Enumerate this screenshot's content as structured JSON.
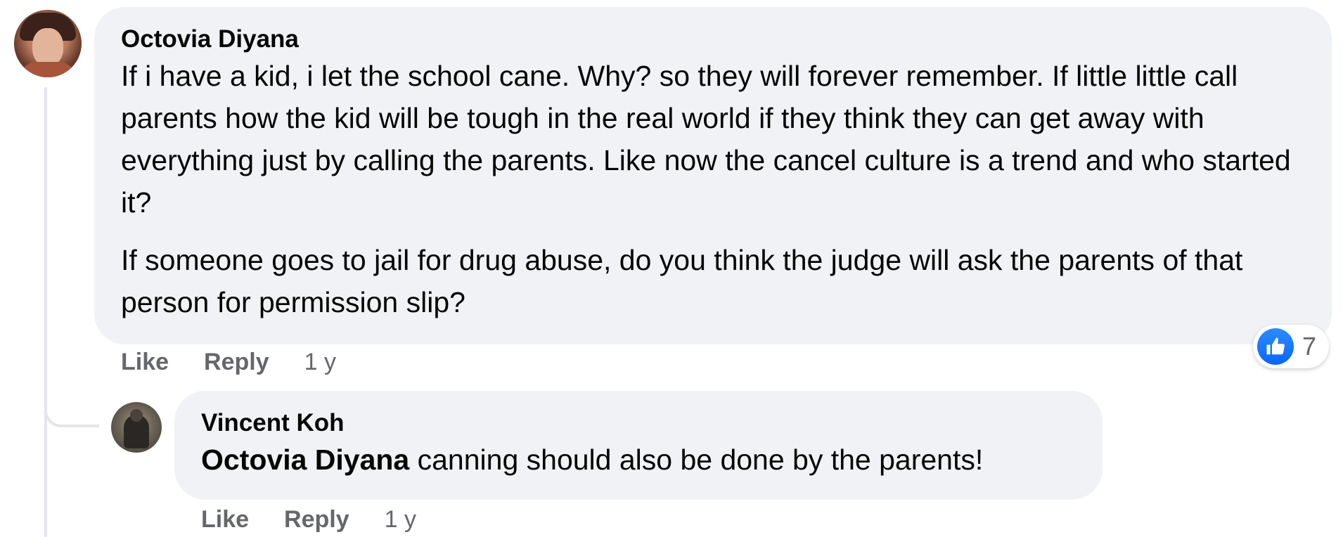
{
  "comment": {
    "author": "Octovia Diyana",
    "paragraphs": [
      "If i have a kid, i let the school cane. Why? so they will forever remember. If little little call parents how the kid will be tough in the real world if they think they can get away with everything just by calling the parents. Like now the cancel culture is a trend and who started it?",
      "If someone goes to jail for drug abuse, do you think the judge will ask the parents of that person for permission slip?"
    ],
    "reaction_count": "7",
    "reaction_icon": "thumbs-up-icon",
    "actions": {
      "like": "Like",
      "reply": "Reply",
      "time": "1 y"
    }
  },
  "reply": {
    "author": "Vincent Koh",
    "mention": "Octovia Diyana",
    "text": " canning should also be done by the parents!",
    "actions": {
      "like": "Like",
      "reply": "Reply",
      "time": "1 y"
    }
  },
  "colors": {
    "bubble": "#f0f2f5",
    "secondary_text": "#65676b",
    "like_blue": "#0866ff"
  }
}
